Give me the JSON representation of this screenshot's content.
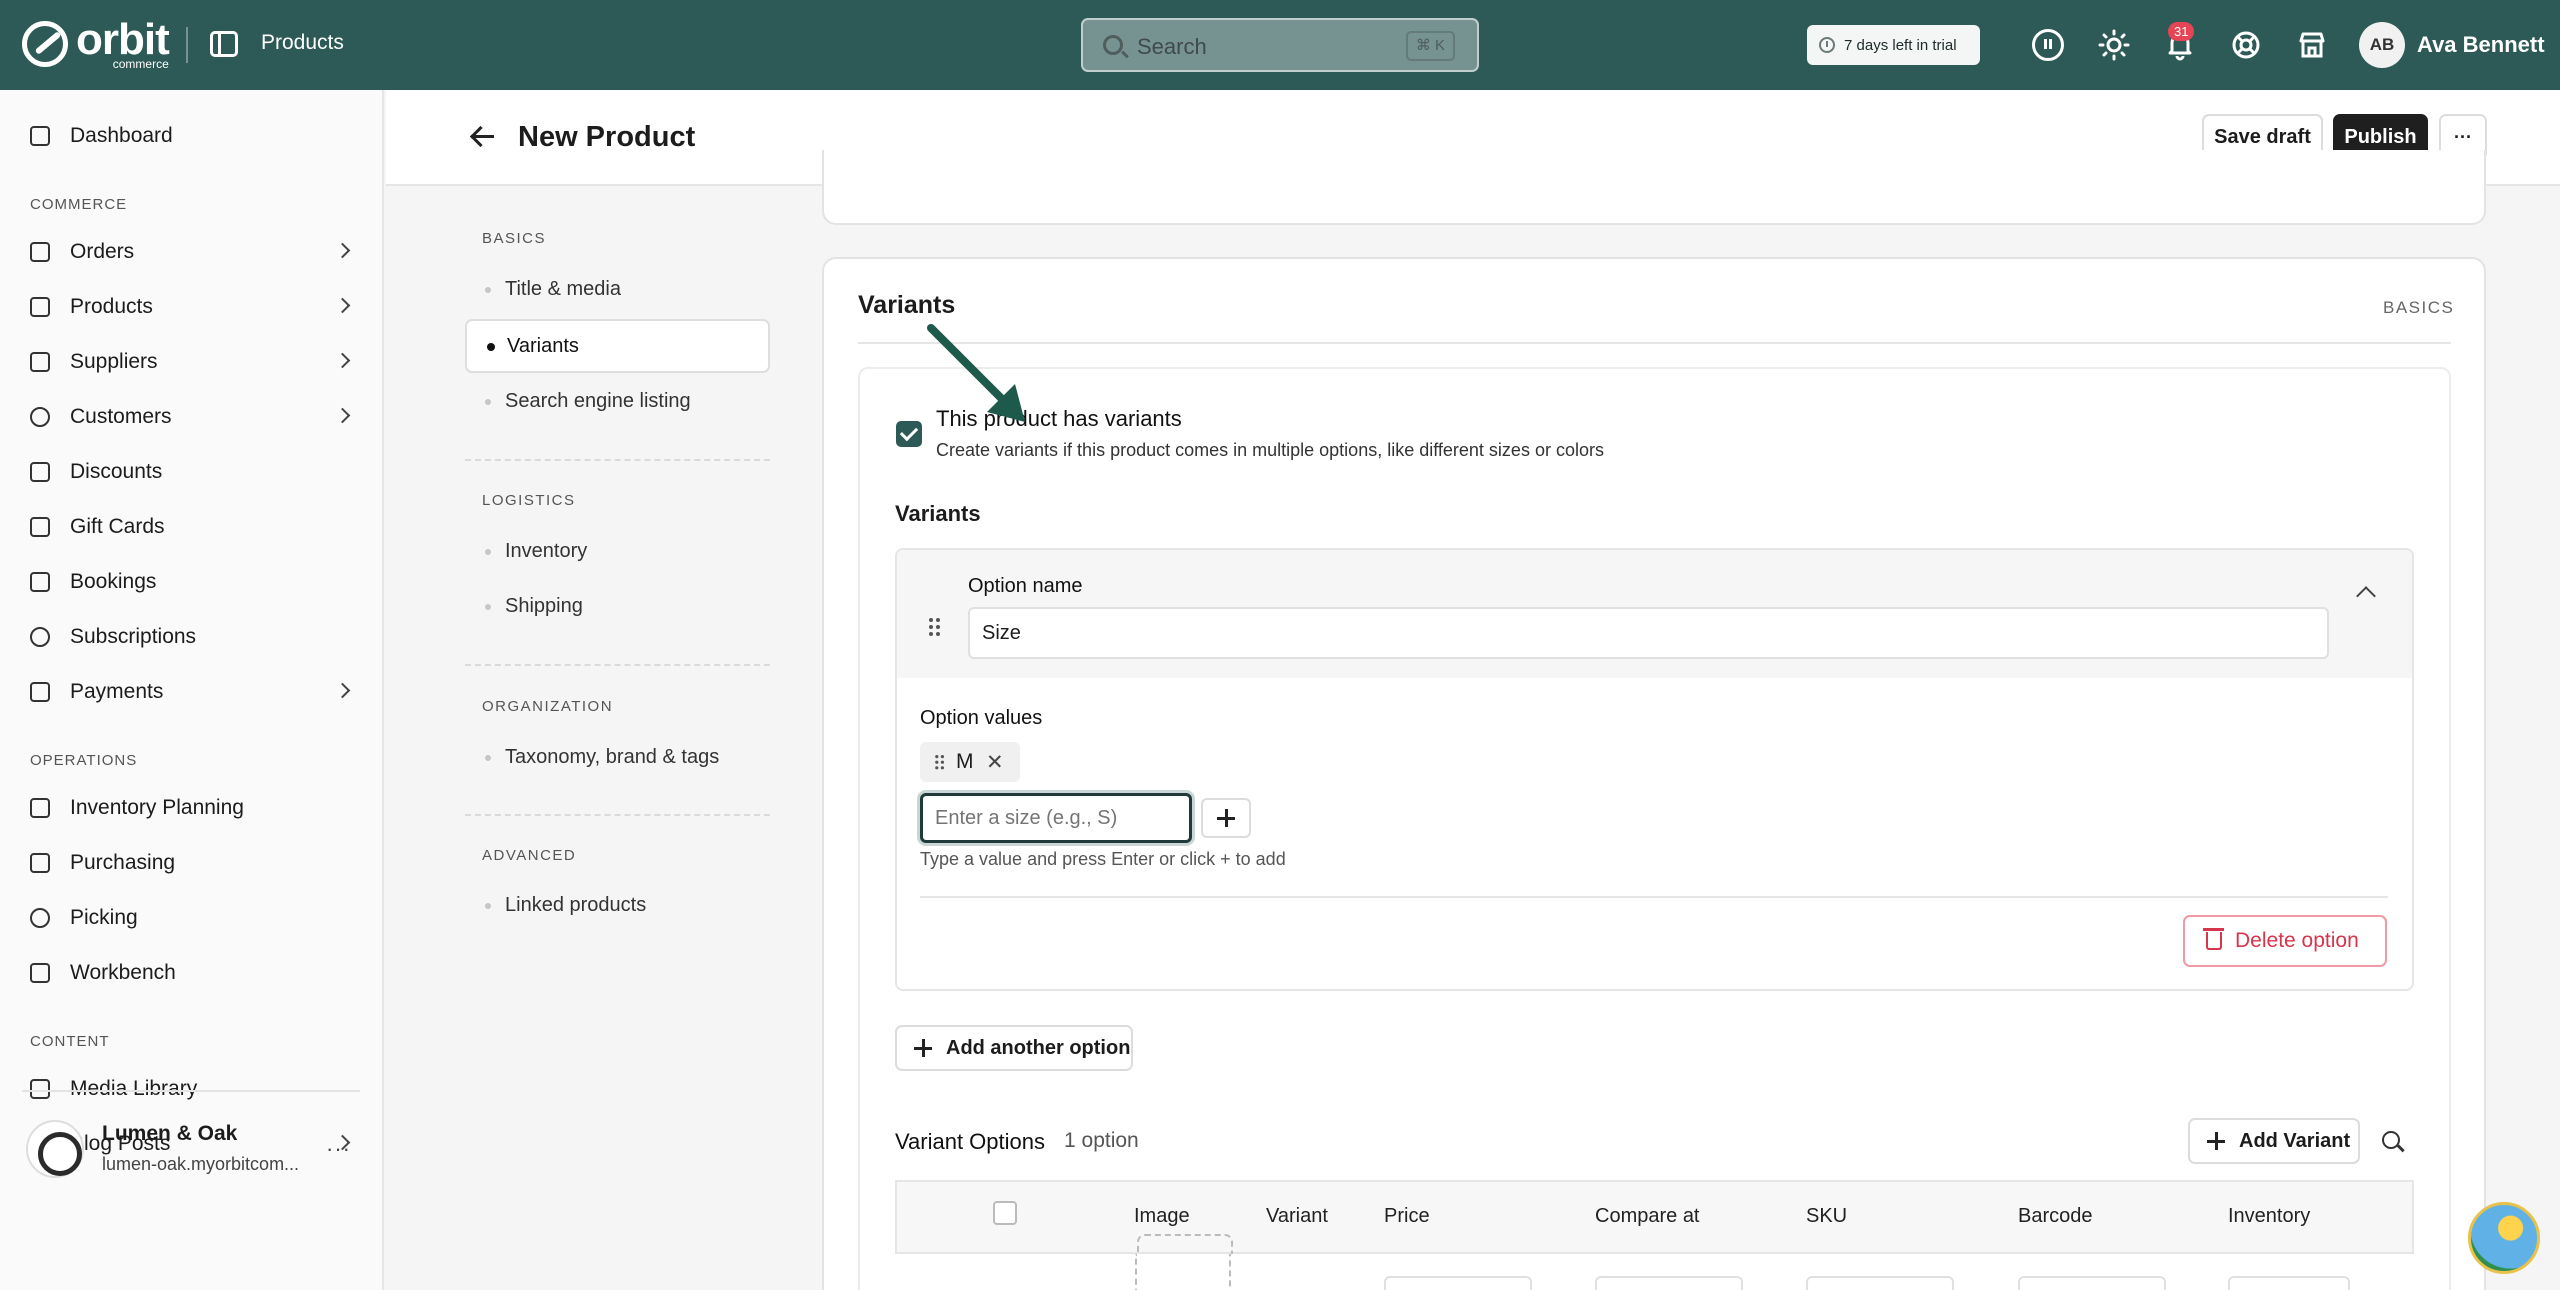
{
  "topbar": {
    "logo_text": "orbit",
    "logo_subtext": "commerce",
    "breadcrumb": "Products",
    "search_placeholder": "Search",
    "search_shortcut": "⌘ K",
    "trial_text": "7 days left in trial",
    "notifications_count": "31",
    "user_initials": "AB",
    "user_name": "Ava Bennett",
    "icons": [
      "sidebar-toggle-icon",
      "search-icon",
      "clock-icon",
      "info-icon",
      "sun-icon",
      "bell-icon",
      "help-icon",
      "store-icon"
    ]
  },
  "sidebar": {
    "items": [
      {
        "label": "Dashboard"
      },
      {
        "label": "Orders"
      },
      {
        "label": "Products"
      },
      {
        "label": "Suppliers"
      },
      {
        "label": "Customers"
      },
      {
        "label": "Discounts"
      },
      {
        "label": "Gift Cards"
      },
      {
        "label": "Bookings"
      },
      {
        "label": "Subscriptions"
      },
      {
        "label": "Payments"
      },
      {
        "label": "Inventory Planning"
      },
      {
        "label": "Purchasing"
      },
      {
        "label": "Picking"
      },
      {
        "label": "Workbench"
      },
      {
        "label": "Media Library"
      },
      {
        "label": "Blog Posts"
      }
    ],
    "sections": {
      "commerce": "COMMERCE",
      "operations": "OPERATIONS",
      "content": "CONTENT"
    },
    "store": {
      "name": "Lumen & Oak",
      "url": "lumen-oak.myorbitcom...",
      "more": "···"
    }
  },
  "header": {
    "title": "New Product",
    "save_draft": "Save draft",
    "publish": "Publish",
    "more": "···"
  },
  "section_nav": {
    "groups": [
      {
        "title": "BASICS",
        "items": [
          "Title & media",
          "Variants",
          "Search engine listing"
        ]
      },
      {
        "title": "LOGISTICS",
        "items": [
          "Inventory",
          "Shipping"
        ]
      },
      {
        "title": "ORGANIZATION",
        "items": [
          "Taxonomy, brand & tags"
        ]
      },
      {
        "title": "ADVANCED",
        "items": [
          "Linked products"
        ]
      }
    ],
    "active": "Variants"
  },
  "variants_card": {
    "title": "Variants",
    "tag": "BASICS",
    "has_variants_label": "This product has variants",
    "has_variants_help": "Create variants if this product comes in multiple options, like different sizes or colors",
    "has_variants_checked": true,
    "subsection_title": "Variants",
    "option": {
      "name_label": "Option name",
      "name_value": "Size",
      "values_label": "Option values",
      "values": [
        "M"
      ],
      "value_placeholder": "Enter a size (e.g., S)",
      "value_help": "Type a value and press Enter or click + to add",
      "delete_label": "Delete option"
    },
    "add_option_label": "Add another option",
    "variant_options_title": "Variant Options",
    "variant_options_count": "1 option",
    "add_variant_label": "Add Variant",
    "table_headers": [
      "Image",
      "Variant",
      "Price",
      "Compare at",
      "SKU",
      "Barcode",
      "Inventory"
    ]
  },
  "colors": {
    "brand": "#2d5a56",
    "danger": "#d8354d"
  }
}
